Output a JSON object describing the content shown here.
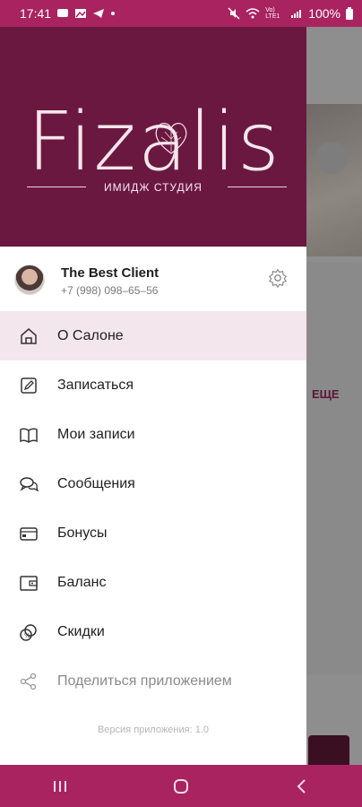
{
  "status": {
    "time": "17:41",
    "battery": "100%",
    "network": "Vo) LTE1"
  },
  "brand": {
    "logo": "Fizalis",
    "subtitle": "ИМИДЖ СТУДИЯ",
    "hero_color": "#6b1840",
    "accent": "#a8235f"
  },
  "profile": {
    "name": "The Best Client",
    "phone": "+7 (998) 098–65–56"
  },
  "menu": [
    {
      "label": "О Салоне",
      "icon": "home-icon",
      "active": true
    },
    {
      "label": "Записаться",
      "icon": "edit-icon"
    },
    {
      "label": "Мои записи",
      "icon": "book-icon"
    },
    {
      "label": "Сообщения",
      "icon": "chat-icon"
    },
    {
      "label": "Бонусы",
      "icon": "card-icon"
    },
    {
      "label": "Баланс",
      "icon": "wallet-icon"
    },
    {
      "label": "Скидки",
      "icon": "discount-icon"
    },
    {
      "label": "Поделиться приложением",
      "icon": "share-icon",
      "disabled": true
    }
  ],
  "version": "Версия приложения: 1.0",
  "background": {
    "more_label": "ЕЩЕ"
  }
}
